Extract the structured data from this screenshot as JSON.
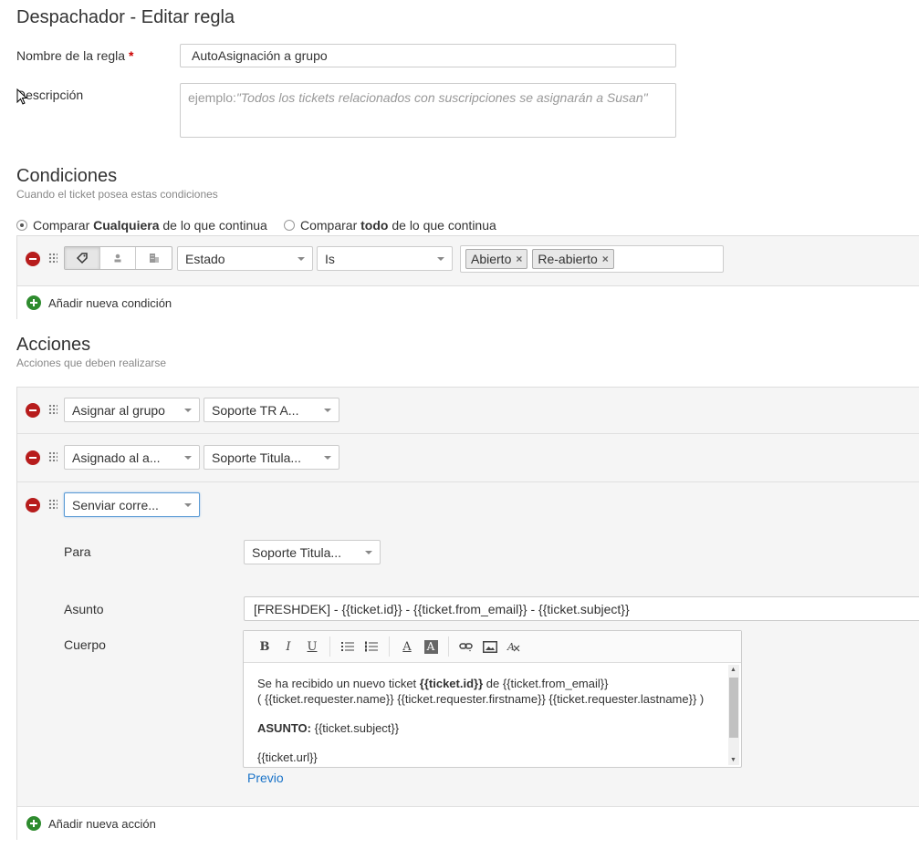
{
  "page": {
    "title": "Despachador - Editar regla"
  },
  "form": {
    "name_label": "Nombre de la regla",
    "required_mark": "*",
    "name_value": "AutoAsignación a grupo",
    "description_label": "Descripción",
    "description_placeholder_prefix": "ejemplo: ",
    "description_placeholder_example": "\"Todos los tickets relacionados con suscripciones se asignarán a Susan\""
  },
  "conditions": {
    "title": "Condiciones",
    "subtitle": "Cuando el ticket posea estas condiciones",
    "match_any": {
      "pre": "Comparar ",
      "bold": "Cualquiera",
      "post": " de lo que continua",
      "selected": true
    },
    "match_all": {
      "pre": "Comparar ",
      "bold": "todo",
      "post": " de lo que continua",
      "selected": false
    },
    "row": {
      "field": "Estado",
      "operator": "Is",
      "values": [
        "Abierto",
        "Re-abierto"
      ],
      "remove_glyph": "×"
    },
    "add_label": "Añadir nueva condición"
  },
  "actions": {
    "title": "Acciones",
    "subtitle": "Acciones que deben realizarse",
    "rows": [
      {
        "action": "Asignar al grupo",
        "value": "Soporte TR A..."
      },
      {
        "action": "Asignado al a...",
        "value": "Soporte Titula..."
      },
      {
        "action": "Senviar corre..."
      }
    ],
    "email": {
      "to_label": "Para",
      "to_value": "Soporte Titula...",
      "subject_label": "Asunto",
      "subject_value": "[FRESHDEK] - {{ticket.id}} - {{ticket.from_email}} - {{ticket.subject}}",
      "body_label": "Cuerpo",
      "toolbar": {
        "bold": "B",
        "italic": "I",
        "underline": "U",
        "font_color": "A",
        "bg_color": "A"
      },
      "body": {
        "line1_pre": "Se ha recibido un nuevo ticket ",
        "line1_bold": "{{ticket.id}}",
        "line1_post": " de {{ticket.from_email}}",
        "line2": "( {{ticket.requester.name}} {{ticket.requester.firstname}} {{ticket.requester.lastname}} )",
        "line3_bold": "ASUNTO:",
        "line3_post": " {{ticket.subject}}",
        "line4": "{{ticket.url}}"
      },
      "preview_label": "Previo"
    },
    "add_label": "Añadir nueva acción"
  }
}
